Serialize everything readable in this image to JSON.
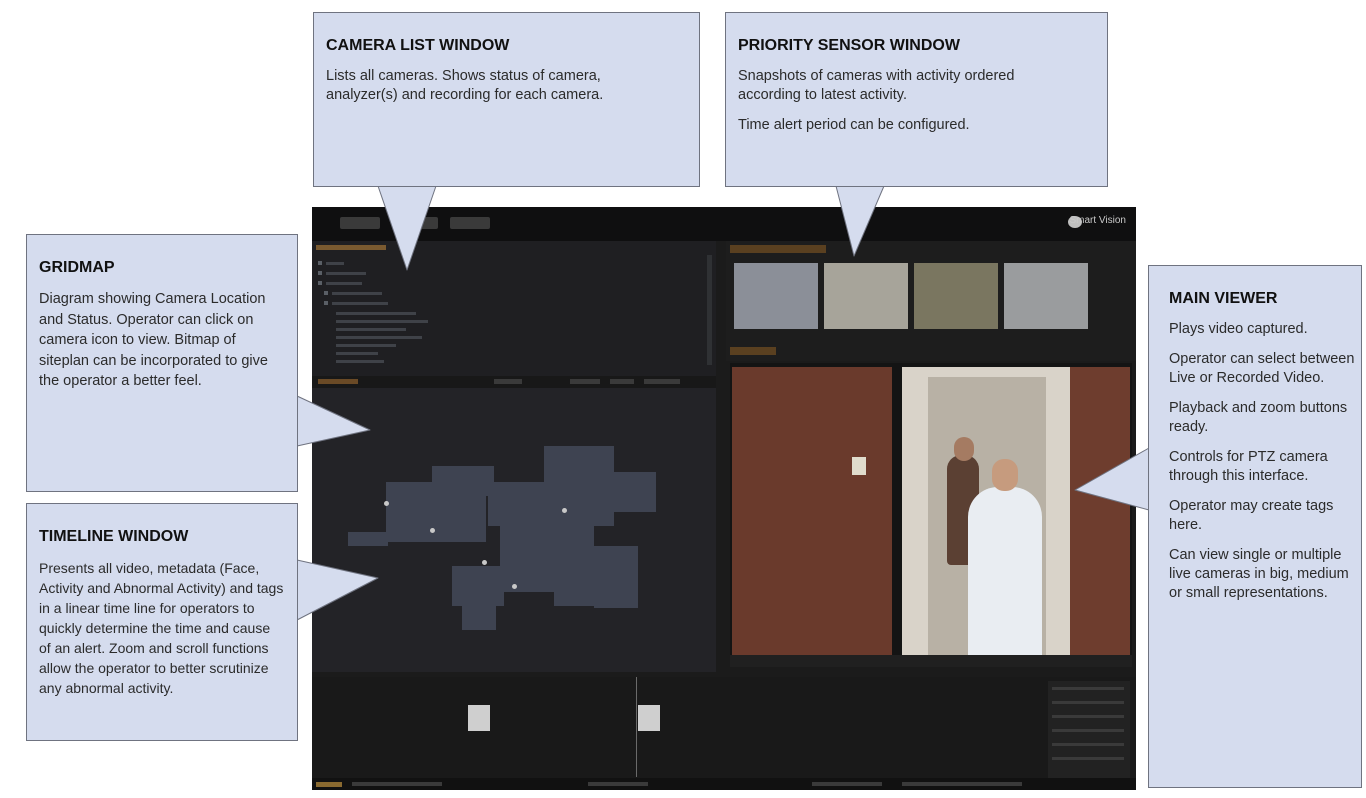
{
  "screenshot": {
    "logo_text": "Smart Vision",
    "colors": {
      "background": "#1b1b1b",
      "callout_fill": "#d5dcee",
      "callout_border": "#6f7380"
    }
  },
  "callouts": {
    "camera_list": {
      "title": "CAMERA LIST WINDOW",
      "paragraphs": [
        "Lists all cameras. Shows status of camera, analyzer(s) and recording for each camera."
      ]
    },
    "priority_sensor": {
      "title": "PRIORITY SENSOR WINDOW",
      "paragraphs": [
        "Snapshots of cameras with activity ordered according to latest activity.",
        "Time alert period can be configured."
      ]
    },
    "gridmap": {
      "title": "GRIDMAP",
      "paragraphs": [
        "Diagram showing Camera Location and Status. Operator can click on camera icon to view. Bitmap of siteplan can be incorporated to give the operator a better feel."
      ]
    },
    "timeline": {
      "title": "TIMELINE WINDOW",
      "paragraphs": [
        "Presents all video, metadata (Face, Activity and Abnormal Activity) and tags in a linear time line for operators to quickly determine the time and cause of an alert. Zoom and scroll functions allow the operator to better scrutinize any abnormal activity."
      ]
    },
    "main_viewer": {
      "title": "MAIN VIEWER",
      "paragraphs": [
        "Plays video captured.",
        "Operator can select between Live or Recorded Video.",
        "Playback and zoom buttons ready.",
        "Controls for PTZ camera through this interface.",
        "Operator may create tags here.",
        "Can view single or multiple live cameras in big, medium or small representations."
      ]
    }
  }
}
